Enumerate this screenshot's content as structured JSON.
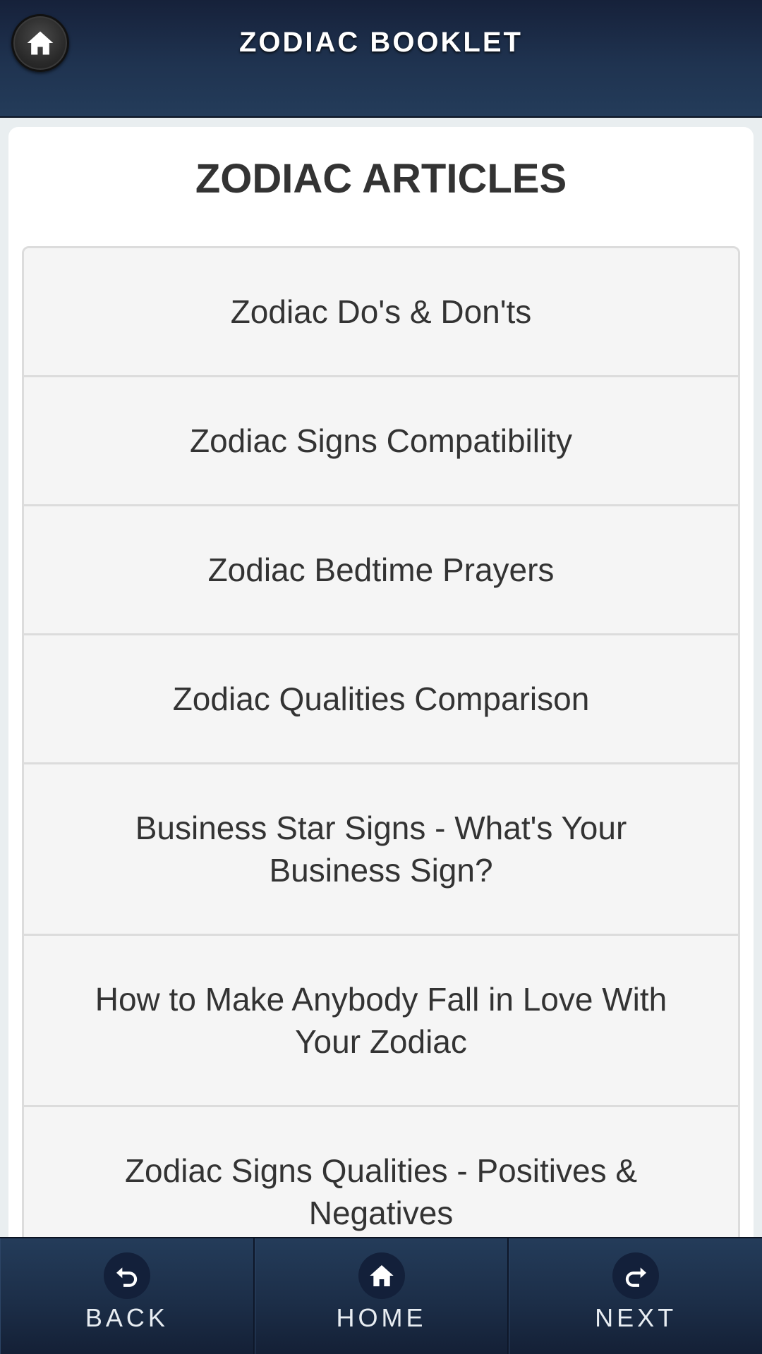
{
  "header": {
    "title": "ZODIAC BOOKLET",
    "home_icon": "home-icon"
  },
  "main": {
    "section_title": "ZODIAC ARTICLES",
    "articles": [
      {
        "label": "Zodiac Do's & Don'ts"
      },
      {
        "label": "Zodiac Signs Compatibility"
      },
      {
        "label": "Zodiac Bedtime Prayers"
      },
      {
        "label": "Zodiac Qualities Comparison"
      },
      {
        "label": "Business Star Signs - What's Your Business Sign?"
      },
      {
        "label": "How to Make Anybody Fall in Love With Your Zodiac"
      },
      {
        "label": "Zodiac Signs Qualities - Positives & Negatives"
      }
    ]
  },
  "bottom_nav": {
    "back": {
      "label": "BACK",
      "icon": "undo-arrow-icon"
    },
    "home": {
      "label": "HOME",
      "icon": "home-icon"
    },
    "next": {
      "label": "NEXT",
      "icon": "redo-arrow-icon"
    }
  },
  "colors": {
    "header_bg": "#1f3350",
    "card_bg": "#ffffff",
    "list_bg": "#f5f5f5",
    "text": "#333333"
  }
}
